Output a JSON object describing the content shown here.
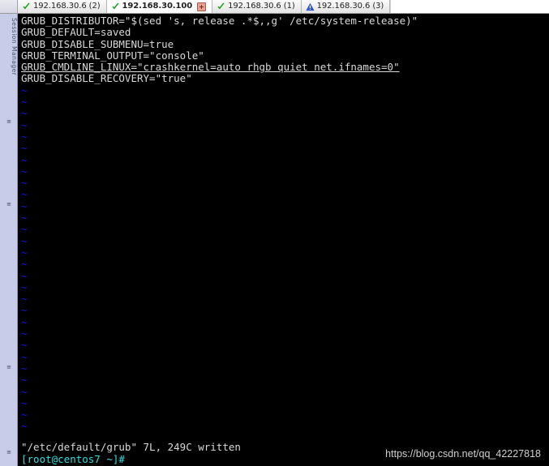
{
  "window": {
    "sidebar_label": "Session Manager"
  },
  "tabbar": {
    "tabs": [
      {
        "label": "192.168.30.6 (2)",
        "status_icon": "check-icon",
        "active": false,
        "closable": false
      },
      {
        "label": "192.168.30.100",
        "status_icon": "check-icon",
        "active": true,
        "closable": true
      },
      {
        "label": "192.168.30.6 (1)",
        "status_icon": "check-icon",
        "active": false,
        "closable": false
      },
      {
        "label": "192.168.30.6 (3)",
        "status_icon": "warning-icon",
        "active": false,
        "closable": false
      }
    ],
    "close_icon_name": "close-icon"
  },
  "terminal": {
    "lines": [
      {
        "text": "GRUB_DISTRIBUTOR=\"$(sed 's, release .*$,,g' /etc/system-release)\"",
        "underline": false
      },
      {
        "text": "GRUB_DEFAULT=saved",
        "underline": false
      },
      {
        "text": "GRUB_DISABLE_SUBMENU=true",
        "underline": false
      },
      {
        "text": "GRUB_TERMINAL_OUTPUT=\"console\"",
        "underline": false
      },
      {
        "text": "GRUB_CMDLINE_LINUX=\"crashkernel=auto rhgb quiet net.ifnames=0\"",
        "underline": true
      },
      {
        "text": "GRUB_DISABLE_RECOVERY=\"true\"",
        "underline": false
      }
    ],
    "empty_marker": "~",
    "empty_marker_count": 30,
    "empty_marker_color": "#1414e0",
    "status_message": "\"/etc/default/grub\" 7L, 249C written",
    "prompt": "[root@centos7 ~]#",
    "prompt_color": "#2ee0e0",
    "background": "#000000",
    "foreground": "#d8d8d8"
  },
  "watermark": {
    "text": "https://blog.csdn.net/qq_42227818"
  },
  "sidebar": {
    "marks": [
      "≡",
      "≡",
      "≡",
      "≡"
    ]
  }
}
